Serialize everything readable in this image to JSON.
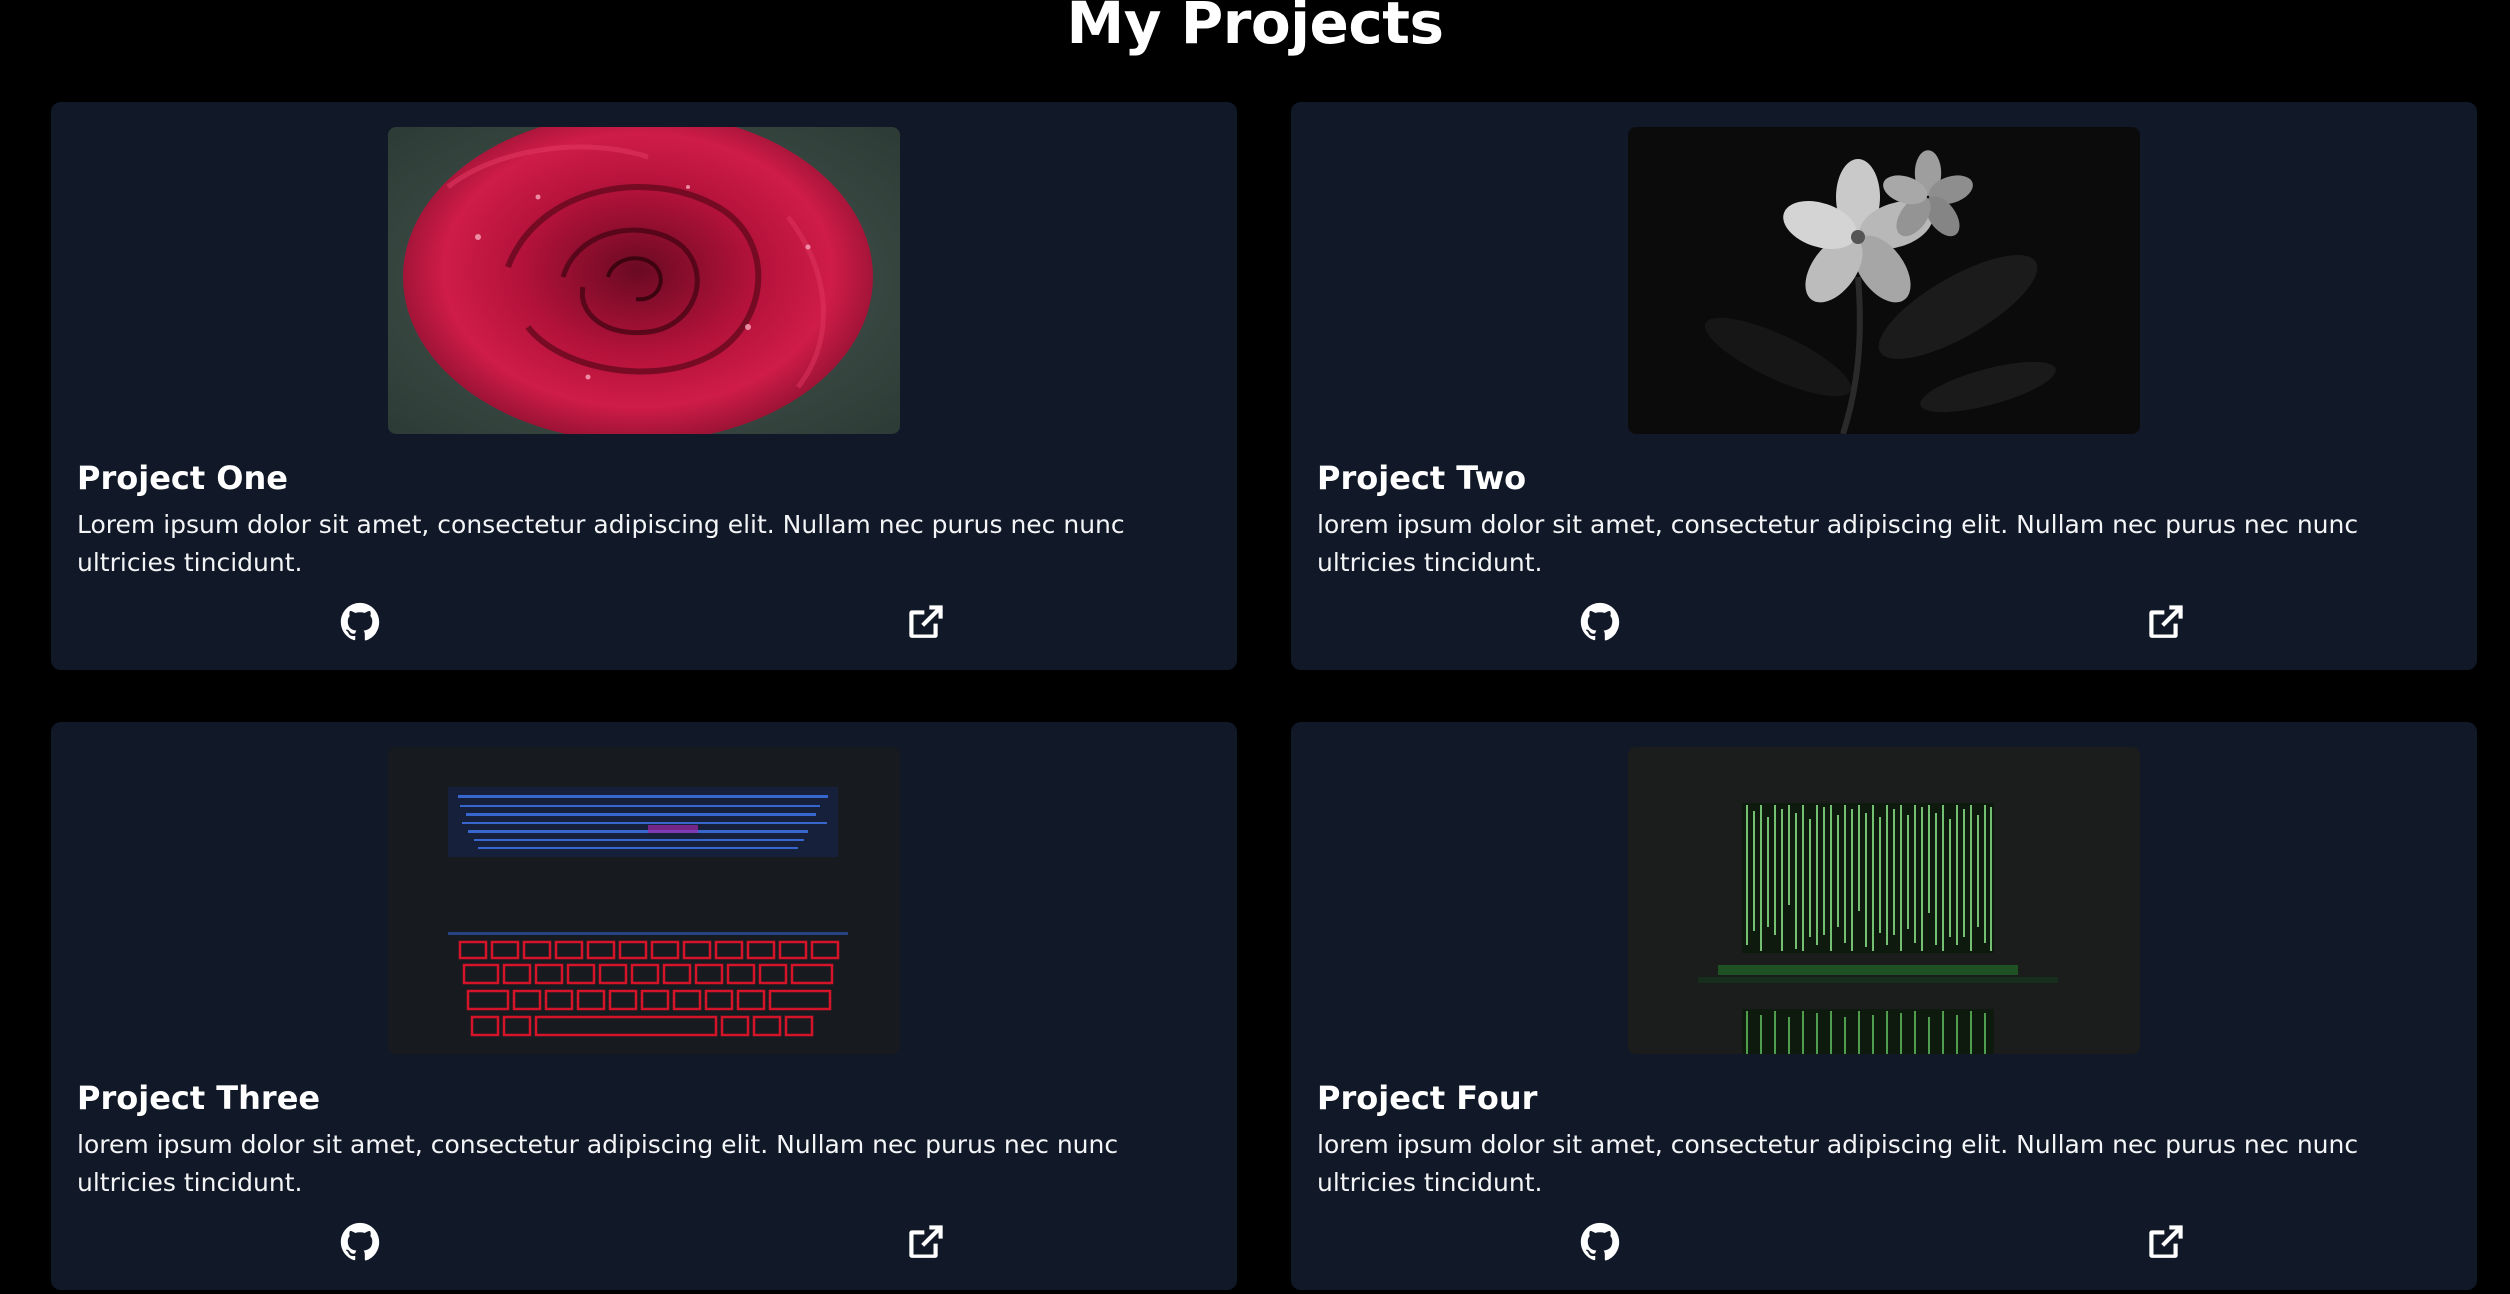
{
  "page": {
    "title": "My Projects"
  },
  "colors": {
    "background": "#000000",
    "card": "#111827",
    "text": "#ffffff"
  },
  "projects": [
    {
      "title": "Project One",
      "description": "Lorem ipsum dolor sit amet, consectetur adipiscing elit. Nullam nec purus nec nunc ultricies tincidunt.",
      "image": "red-rose-photo",
      "github_icon": "github-icon",
      "external_icon": "external-link-icon"
    },
    {
      "title": "Project Two",
      "description": "lorem ipsum dolor sit amet, consectetur adipiscing elit. Nullam nec purus nec nunc ultricies tincidunt.",
      "image": "white-flower-bw-photo",
      "github_icon": "github-icon",
      "external_icon": "external-link-icon"
    },
    {
      "title": "Project Three",
      "description": "lorem ipsum dolor sit amet, consectetur adipiscing elit. Nullam nec purus nec nunc ultricies tincidunt.",
      "image": "backlit-keyboard-photo",
      "github_icon": "github-icon",
      "external_icon": "external-link-icon"
    },
    {
      "title": "Project Four",
      "description": "lorem ipsum dolor sit amet, consectetur adipiscing elit. Nullam nec purus nec nunc ultricies tincidunt.",
      "image": "matrix-code-laptop-photo",
      "github_icon": "github-icon",
      "external_icon": "external-link-icon"
    }
  ]
}
